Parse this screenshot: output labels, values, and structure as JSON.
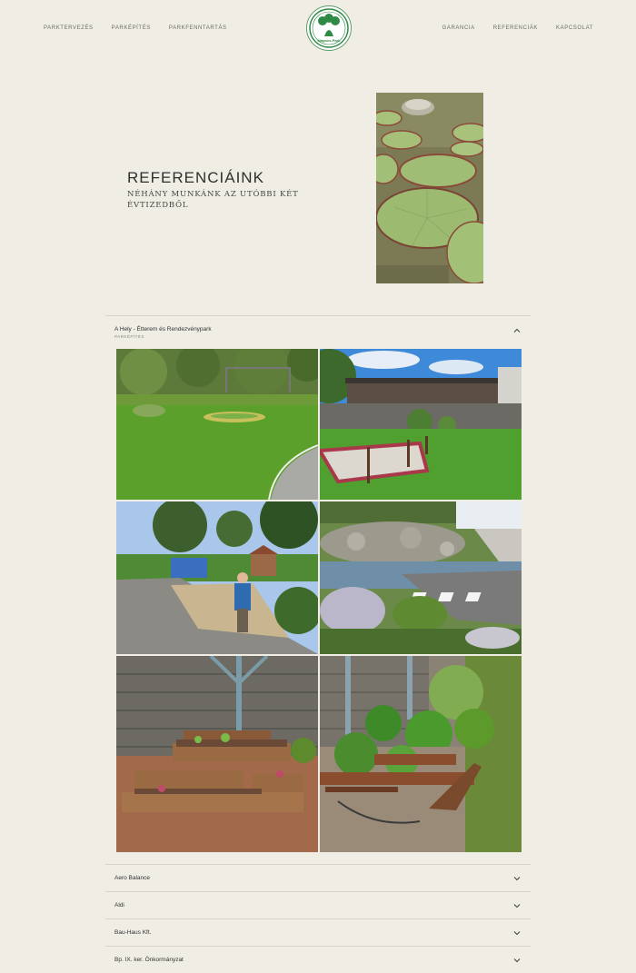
{
  "nav": {
    "left": [
      "Parktervezés",
      "Parképítés",
      "Parkfenntartás"
    ],
    "right": [
      "Garancia",
      "Referenciák",
      "Kapcsolat"
    ]
  },
  "logo": {
    "text": "Mágnes-Park",
    "color": "#2f8a45"
  },
  "hero": {
    "title": "REFERENCIÁINK",
    "subtitle": "NÉHÁNY MUNKÁNK AZ UTÓBBI KÉT ÉVTIZEDBŐL"
  },
  "references": {
    "open_item": {
      "title": "A Hely - Étterem és Rendezvénypark",
      "tag": "Parképítés"
    },
    "gallery_icons": [
      "lawn-garden-photo",
      "terrace-flowerbed-photo",
      "gardener-playground-photo",
      "rock-garden-photo",
      "raised-beds-photo",
      "raised-beds-planted-photo"
    ],
    "items": [
      "Aero Balance",
      "Aldi",
      "Bau-Haus Kft.",
      "Bp. IX. ker. Önkormányzat"
    ]
  },
  "colors": {
    "background": "#efede4",
    "accent": "#2f8a45"
  }
}
